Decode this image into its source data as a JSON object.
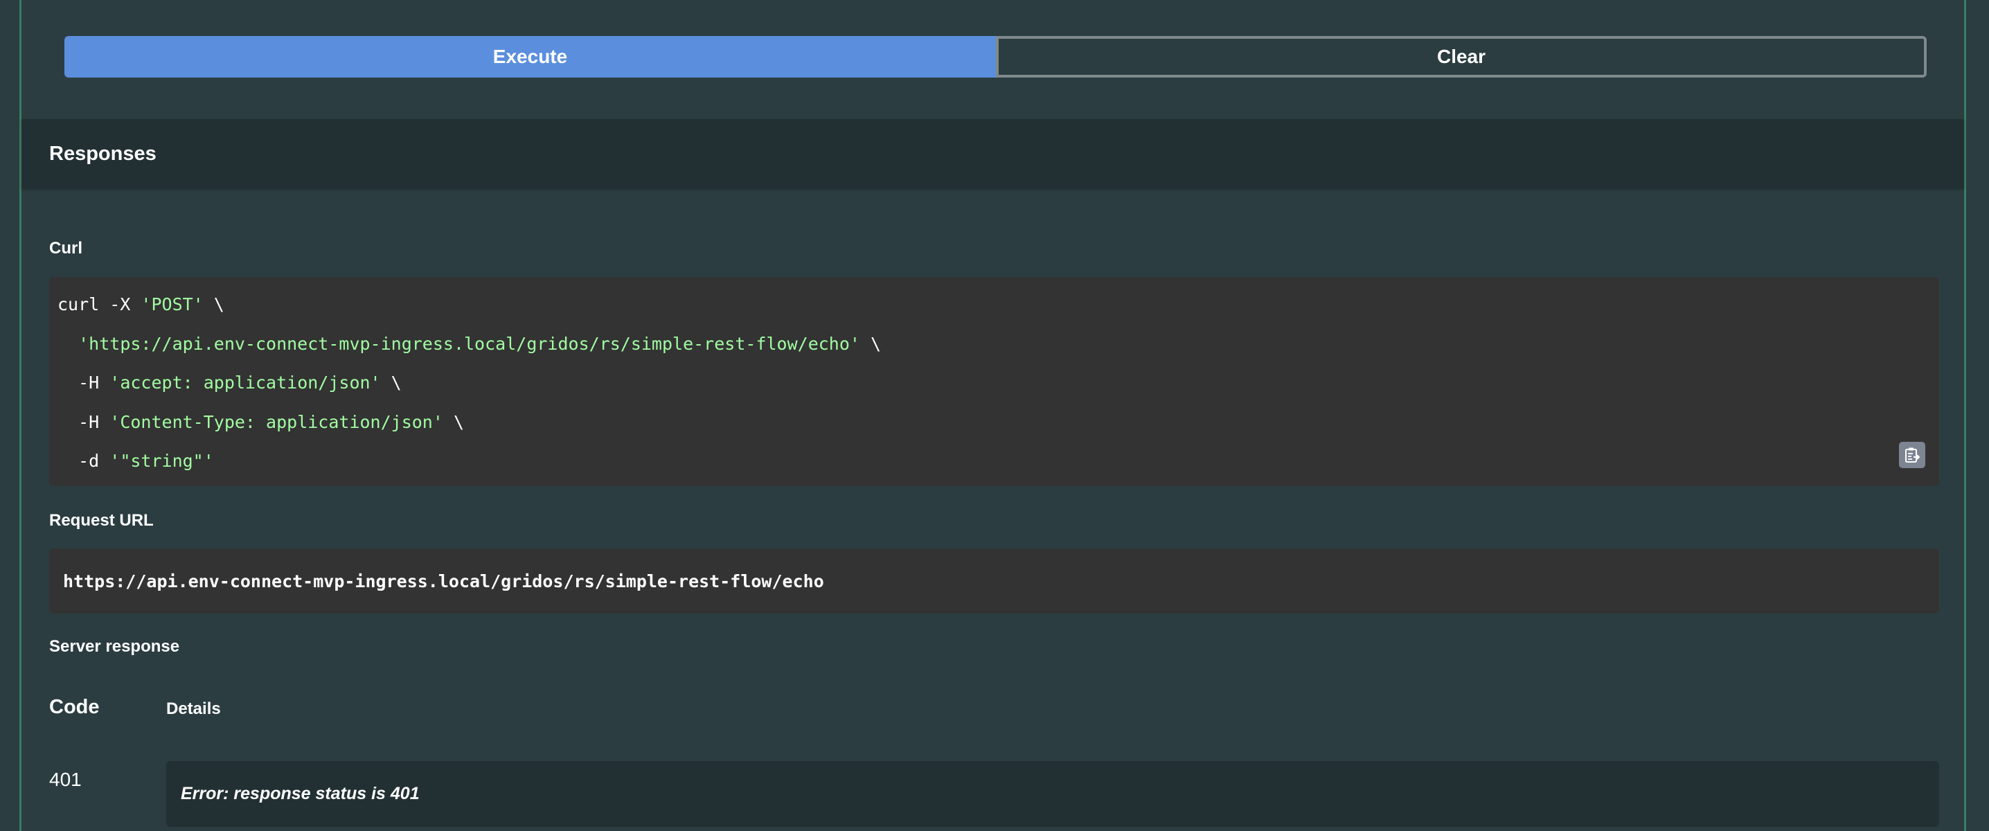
{
  "actions": {
    "execute_label": "Execute",
    "clear_label": "Clear"
  },
  "responses": {
    "title": "Responses"
  },
  "curl": {
    "label": "Curl",
    "line1_cmd": "curl -X ",
    "line1_method": "'POST'",
    "line1_cont": " \\",
    "line2_url": "'https://api.env-connect-mvp-ingress.local/gridos/rs/simple-rest-flow/echo'",
    "line2_cont": " \\",
    "line3_flag": "  -H ",
    "line3_val": "'accept: application/json'",
    "line3_cont": " \\",
    "line4_flag": "  -H ",
    "line4_val": "'Content-Type: application/json'",
    "line4_cont": " \\",
    "line5_flag": "  -d ",
    "line5_val": "'\"string\"'",
    "copy_icon": "clipboard-copy-icon"
  },
  "request_url": {
    "label": "Request URL",
    "value": "https://api.env-connect-mvp-ingress.local/gridos/rs/simple-rest-flow/echo"
  },
  "server_response": {
    "label": "Server response",
    "code_header": "Code",
    "details_header": "Details",
    "code": "401",
    "details": "Error: response status is 401"
  },
  "colors": {
    "execute_bg": "#5b8fdd",
    "panel_bg": "#2b3d41",
    "code_bg": "#333333",
    "string_color": "#a2fca2",
    "panel_border": "#3a7d63"
  }
}
